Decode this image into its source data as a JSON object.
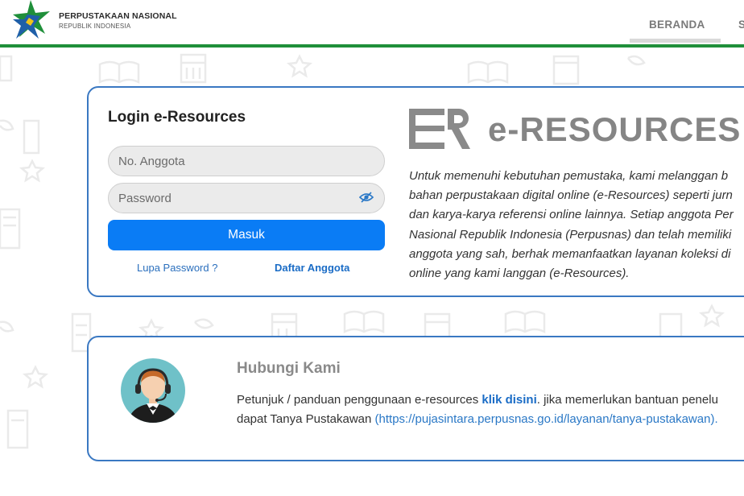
{
  "header": {
    "brand_title": "PERPUSTAKAAN NASIONAL",
    "brand_subtitle": "REPUBLIK INDONESIA",
    "nav": [
      {
        "label": "BERANDA"
      },
      {
        "label": "S"
      }
    ],
    "accent_color": "#1f8f3a"
  },
  "login": {
    "title": "Login e-Resources",
    "member_placeholder": "No. Anggota",
    "password_placeholder": "Password",
    "submit_label": "Masuk",
    "forgot_label": "Lupa Password ?",
    "register_label": "Daftar Anggota",
    "button_color": "#0a7cf5"
  },
  "eresources": {
    "title": "e-RESOURCES",
    "description_lines": [
      "Untuk memenuhi kebutuhan pemustaka, kami melanggan b",
      "bahan perpustakaan digital online (e-Resources) seperti jurn",
      "dan karya-karya referensi online lainnya. Setiap anggota Per",
      "Nasional Republik Indonesia (Perpusnas) dan telah memiliki",
      "anggota yang sah, berhak memanfaatkan layanan koleksi di",
      "online yang kami langgan (e-Resources)."
    ]
  },
  "contact": {
    "title": "Hubungi Kami",
    "line1_prefix": "Petunjuk / panduan penggunaan e-resources ",
    "line1_link": "klik disini",
    "line1_suffix": ". jika memerlukan bantuan penelu",
    "line2_prefix": "dapat Tanya Pustakawan ",
    "line2_link": "(https://pujasintara.perpusnas.go.id/layanan/tanya-pustakawan).",
    "link_color": "#1a6cc6"
  },
  "icons": {
    "logo": "star-logo-icon",
    "eye": "eye-slash-icon",
    "eres_logo": "e-resources-logo-icon",
    "avatar": "customer-service-agent-icon"
  }
}
